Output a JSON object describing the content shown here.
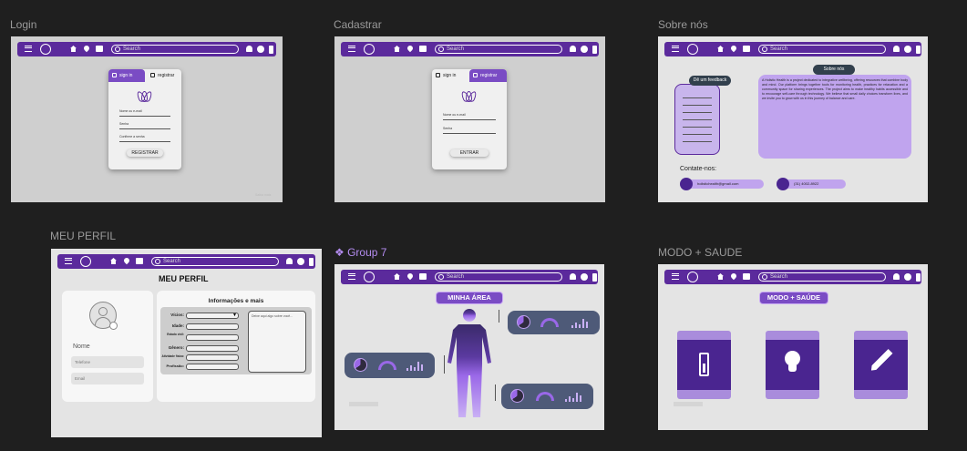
{
  "canvas": {
    "frames": {
      "login": {
        "label": "Login"
      },
      "cadastrar": {
        "label": "Cadastrar"
      },
      "sobre": {
        "label": "Sobre nós"
      },
      "perfil": {
        "label": "MEU PERFIL"
      },
      "group7": {
        "label": "Group 7"
      },
      "modo": {
        "label": "MODO + SAUDE"
      }
    }
  },
  "navbar": {
    "search_placeholder": "Search"
  },
  "login": {
    "tab_signin": "sign in",
    "tab_register": "registrar",
    "field_email": "Nome ou e-mail",
    "field_password": "Senha",
    "field_confirm": "Confirme a senha",
    "button": "REGISTRAR",
    "footnote_right": "Saiba mais"
  },
  "cadastrar": {
    "tab_signin": "sign in",
    "tab_register": "registrar",
    "field_email": "Nome ou e-mail",
    "field_password": "Senha",
    "button": "ENTRAR"
  },
  "sobre": {
    "feedback_title": "Dê um feedback",
    "about_title": "Sobre nós",
    "about_text": "A Holistic Health is a project dedicated to integrative wellbeing, offering resources that combine body and mind. Our platform brings together tools for monitoring health, practices for relaxation and a community space for sharing experiences. The project aims to make healthy habits accessible and to encourage self-care through technology. We believe that small daily choices transform lives, and we invite you to grow with us in this journey of balance and care.",
    "contact_title": "Contate-nos:",
    "email": "holistichealth@gmail.com",
    "phone": "(31) 4002-8922"
  },
  "perfil": {
    "title": "MEU PERFIL",
    "name_label": "Nome",
    "phone_placeholder": "Telefone",
    "email_placeholder": "Email",
    "info_title": "Informações e mais",
    "fields": [
      "Vícios:",
      "Idade:",
      "Estado civil:",
      "Gênero:",
      "Atividade física:",
      "Profissão:"
    ],
    "notes_placeholder": "Deixe aqui algo sobre você..."
  },
  "group7": {
    "title": "MINHA ÁREA"
  },
  "modo": {
    "title": "MODO + SAÚDE"
  },
  "colors": {
    "primary": "#5b2a9c",
    "accent": "#7a4cc4",
    "light_purple": "#a98cdc",
    "canvas": "#1f1f1f",
    "frame_bg": "#e4e4e4"
  }
}
